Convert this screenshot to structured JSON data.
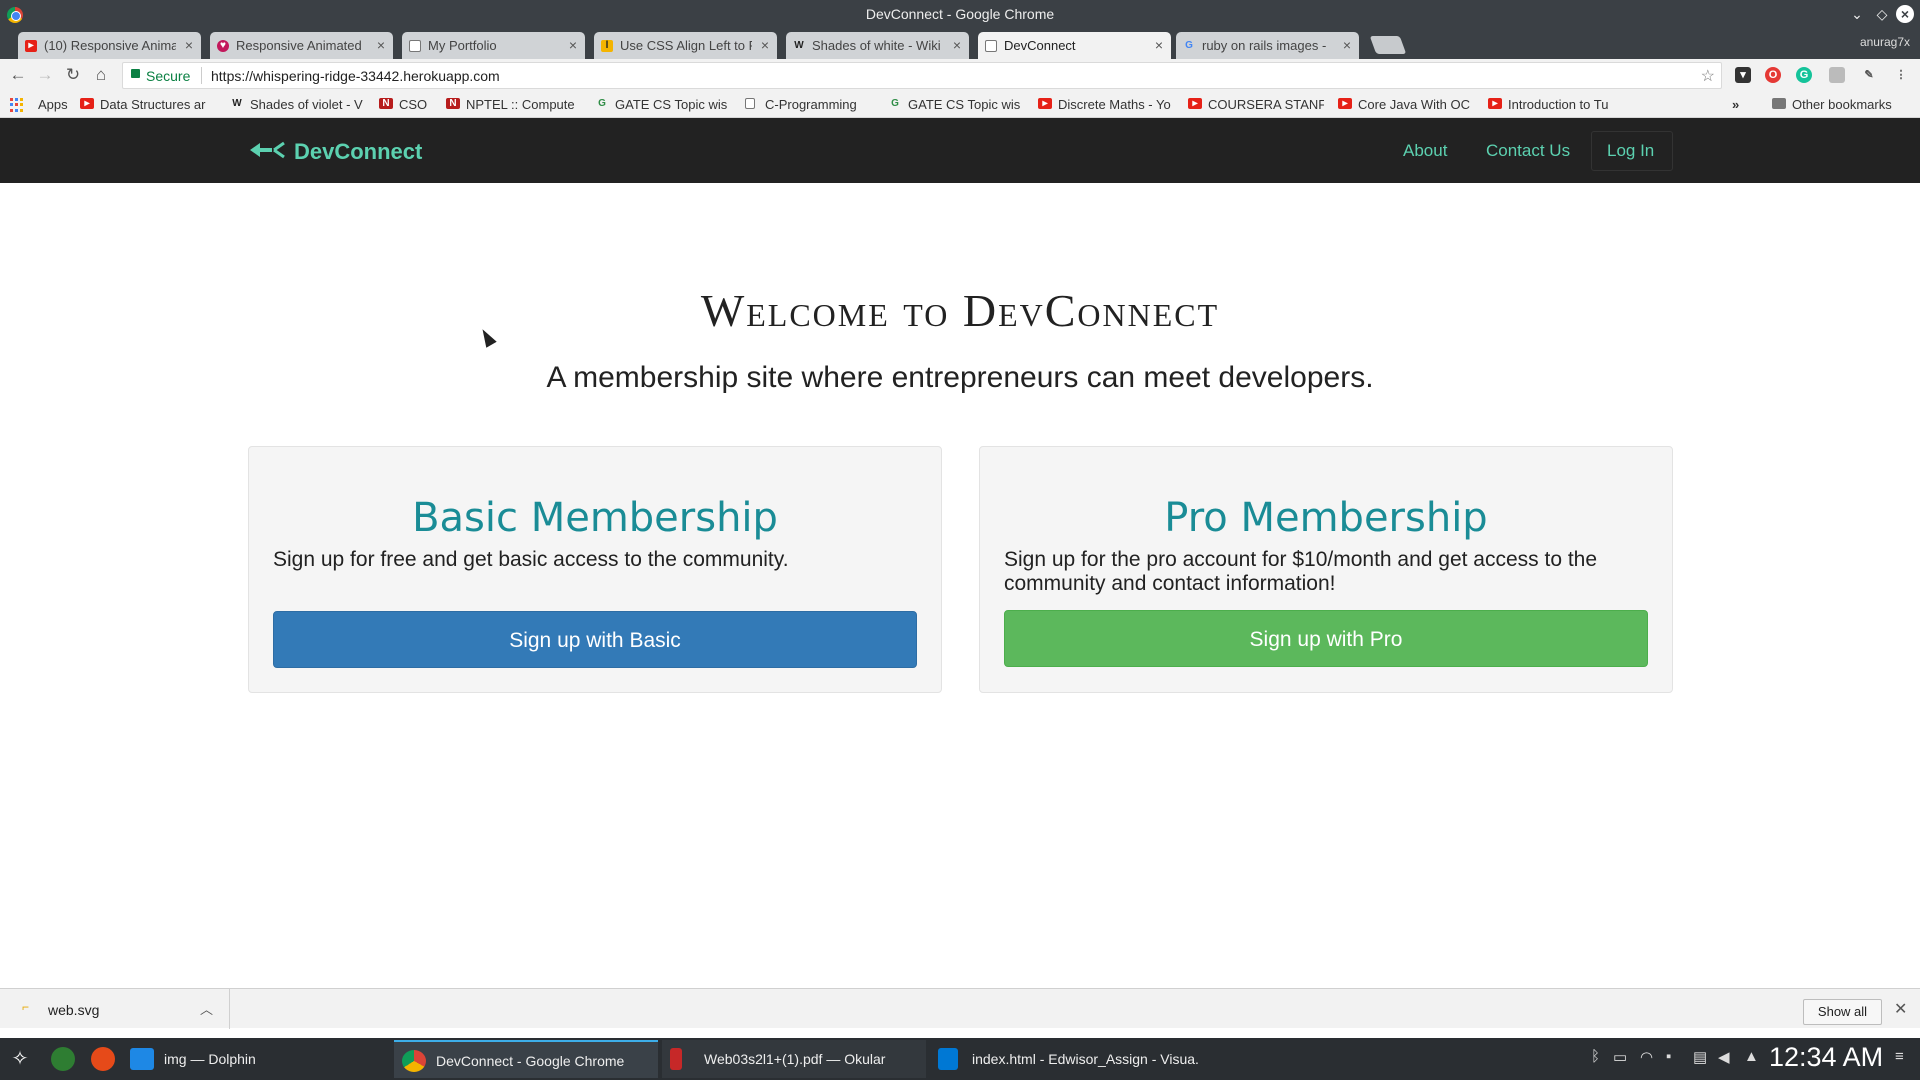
{
  "window": {
    "title": "DevConnect - Google Chrome"
  },
  "tabs": [
    {
      "label": "(10) Responsive Anima",
      "icon": "youtube-icon"
    },
    {
      "label": "Responsive Animated",
      "icon": "heart-icon"
    },
    {
      "label": "My Portfolio",
      "icon": "page-icon"
    },
    {
      "label": "Use CSS Align Left to F",
      "icon": "lightbulb-icon"
    },
    {
      "label": "Shades of white - Wiki",
      "icon": "wikipedia-icon"
    },
    {
      "label": "DevConnect",
      "icon": "page-icon",
      "active": true
    },
    {
      "label": "ruby on rails images - ",
      "icon": "google-icon"
    }
  ],
  "profile_name": "anurag7x",
  "omnibox": {
    "secure_label": "Secure",
    "url": "https://whispering-ridge-33442.herokuapp.com"
  },
  "bookmarks": {
    "apps_label": "Apps",
    "items": [
      {
        "label": "Data Structures ar",
        "icon": "youtube-icon"
      },
      {
        "label": "Shades of violet - V",
        "icon": "wikipedia-icon"
      },
      {
        "label": "CSO",
        "icon": "nptel-icon"
      },
      {
        "label": "NPTEL :: Compute",
        "icon": "nptel-icon"
      },
      {
        "label": "GATE CS Topic wis",
        "icon": "gfg-icon"
      },
      {
        "label": "C-Programming",
        "icon": "page-icon"
      },
      {
        "label": "GATE CS Topic wis",
        "icon": "gfg-icon"
      },
      {
        "label": "Discrete Maths - Yo",
        "icon": "youtube-icon"
      },
      {
        "label": "COURSERA STANF",
        "icon": "youtube-icon"
      },
      {
        "label": "Core Java With OC",
        "icon": "youtube-icon"
      },
      {
        "label": "Introduction to Tu",
        "icon": "youtube-icon"
      }
    ],
    "overflow": "»",
    "other_label": "Other bookmarks"
  },
  "site": {
    "brand": "DevConnect",
    "nav": {
      "about": "About",
      "contact": "Contact Us",
      "login": "Log In"
    },
    "hero": {
      "title": "Welcome to DevConnect",
      "subtitle": "A membership site where entrepreneurs can meet developers."
    },
    "plans": [
      {
        "name": "Basic Membership",
        "description": "Sign up for free and get basic access to the community.",
        "button": "Sign up with Basic"
      },
      {
        "name": "Pro Membership",
        "description": "Sign up for the pro account for $10/month and get access to the community and contact information!",
        "button": "Sign up with Pro"
      }
    ],
    "colors": {
      "brand": "#5cd1b0",
      "heading": "#1a8c96",
      "basic_button": "#337ab7",
      "pro_button": "#5cb85c",
      "navbar": "#222222"
    }
  },
  "downloads": {
    "file": "web.svg",
    "show_all": "Show all"
  },
  "taskbar": {
    "tasks": [
      {
        "label": "img — Dolphin",
        "icon": "dolphin-icon"
      },
      {
        "label": "DevConnect - Google Chrome",
        "icon": "chrome-icon",
        "active": true
      },
      {
        "label": "Web03s2l1+(1).pdf — Okular",
        "icon": "okular-icon"
      },
      {
        "label": "index.html - Edwisor_Assign - Visua...",
        "icon": "vscode-icon"
      }
    ],
    "clock": "12:34 AM"
  }
}
